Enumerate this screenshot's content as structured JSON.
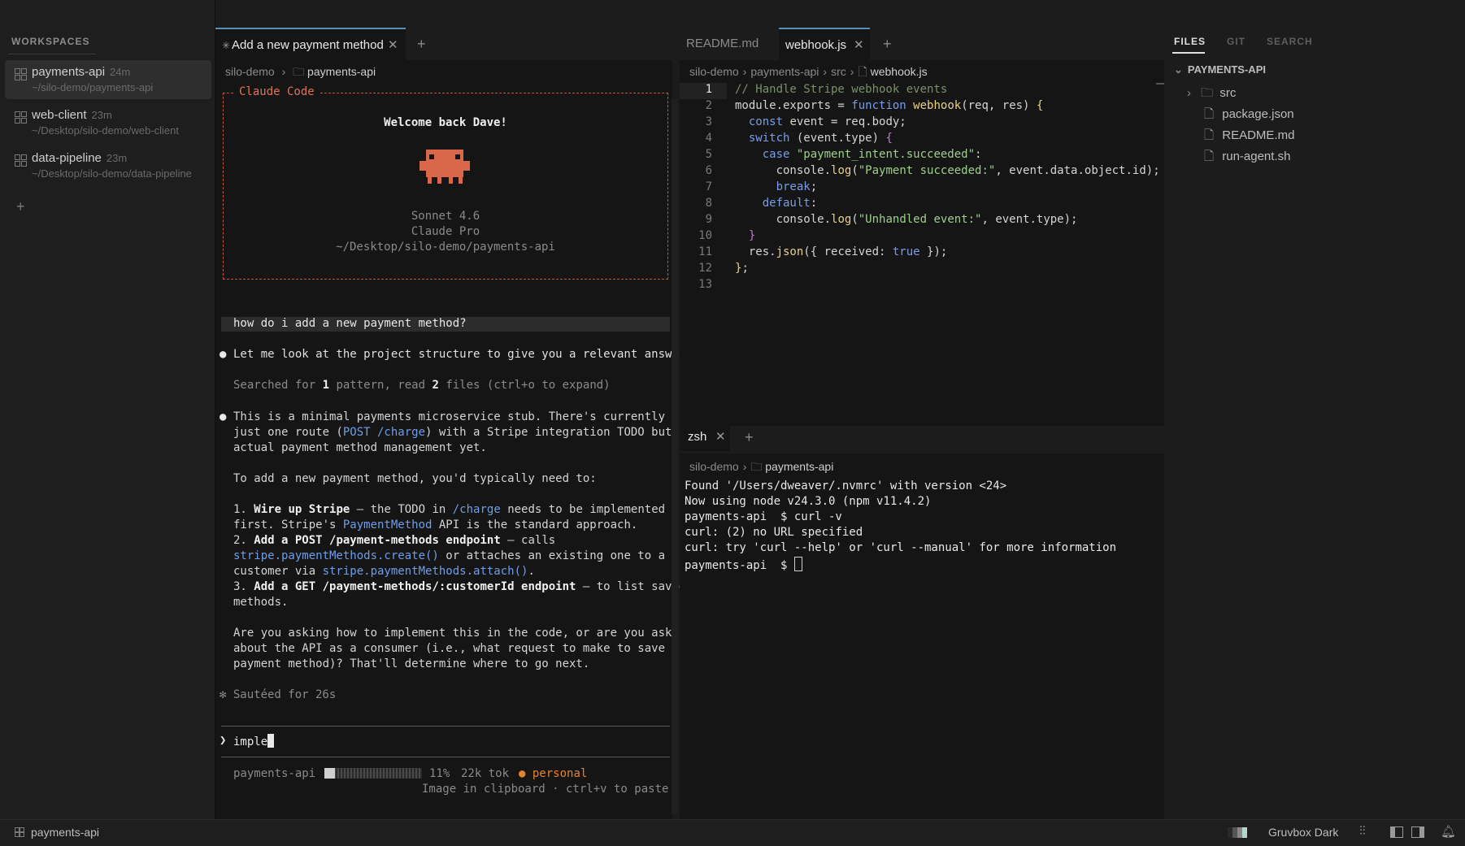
{
  "window": {
    "colors": {
      "close": "#ff5f57",
      "min": "#febc2e",
      "max": "#28c840"
    }
  },
  "sidebar": {
    "title": "WORKSPACES",
    "items": [
      {
        "name": "payments-api",
        "age": "24m",
        "path": "~/silo-demo/payments-api",
        "active": true
      },
      {
        "name": "web-client",
        "age": "23m",
        "path": "~/Desktop/silo-demo/web-client"
      },
      {
        "name": "data-pipeline",
        "age": "23m",
        "path": "~/Desktop/silo-demo/data-pipeline"
      }
    ],
    "add_label": "+"
  },
  "chat": {
    "tab_label": "Add a new payment method",
    "tab_prefix": "✳",
    "breadcrumb": {
      "root": "silo-demo",
      "folder": "payments-api"
    },
    "banner": {
      "title": "Claude Code",
      "welcome": "Welcome back Dave!",
      "model": "Sonnet 4.6",
      "plan": "Claude Pro",
      "cwd": "~/Desktop/silo-demo/payments-api"
    },
    "user_prompt": "how do i add a new payment method?",
    "msg1": "Let me look at the project structure to give you a relevant answer.",
    "search_pre": "Searched for ",
    "search_n1": "1",
    "search_mid": " pattern, read ",
    "search_n2": "2",
    "search_post": " files (ctrl+o to expand)",
    "msg2_l1": "This is a minimal payments microservice stub. There's currently",
    "msg2_l2a": "just one route (",
    "msg2_l2b": "POST /charge",
    "msg2_l2c": ") with a Stripe integration TODO but no",
    "msg2_l3": "actual payment method management yet.",
    "msg3": "To add a new payment method, you'd typically need to:",
    "s1a": "1. ",
    "s1b": "Wire up Stripe",
    "s1c": " — the TODO in ",
    "s1d": "/charge",
    "s1e": " needs to be implemented",
    "s1f": "first. Stripe's ",
    "s1g": "PaymentMethod",
    "s1h": " API is the standard approach.",
    "s2a": "2. ",
    "s2b": "Add a ",
    "s2c": "POST /payment-methods",
    "s2d": " endpoint",
    "s2e": " — calls",
    "s2f": "stripe.paymentMethods.create()",
    "s2g": " or attaches an existing one to a",
    "s2h": "customer via ",
    "s2i": "stripe.paymentMethods.attach()",
    "s2j": ".",
    "s3a": "3. ",
    "s3b": "Add a ",
    "s3c": "GET /payment-methods/:customerId",
    "s3d": " endpoint",
    "s3e": " — to list saved",
    "s3f": "methods.",
    "q1": "Are you asking how to implement this in the code, or are you asking",
    "q2": "about the API as a consumer (i.e., what request to make to save a",
    "q3": "payment method)? That'll determine where to go next.",
    "sauteed": "✻ Sautéed for 26s",
    "input_prompt": "❯",
    "input_value": "imple",
    "status": {
      "project": "payments-api",
      "percent": "11%",
      "progress": 0.11,
      "tokens": "22k tok",
      "account": "personal",
      "hint": "Image in clipboard · ctrl+v to paste"
    }
  },
  "editor": {
    "tabs": [
      {
        "label": "README.md",
        "active": false
      },
      {
        "label": "webhook.js",
        "active": true
      }
    ],
    "breadcrumb": [
      "silo-demo",
      "payments-api",
      "src",
      "webhook.js"
    ],
    "line_numbers": [
      "1",
      "2",
      "3",
      "4",
      "5",
      "6",
      "7",
      "8",
      "9",
      "10",
      "11",
      "12",
      "13"
    ]
  },
  "terminal": {
    "tab_label": "zsh",
    "breadcrumb": {
      "root": "silo-demo",
      "folder": "payments-api"
    },
    "lines": [
      "Found '/Users/dweaver/.nvmrc' with version <24>",
      "Now using node v24.3.0 (npm v11.4.2)",
      "payments-api  $ curl -v",
      "curl: (2) no URL specified",
      "curl: try 'curl --help' or 'curl --manual' for more information",
      "payments-api  $ "
    ]
  },
  "files_panel": {
    "tabs": [
      "FILES",
      "GIT",
      "SEARCH"
    ],
    "root": "PAYMENTS-API",
    "entries": [
      {
        "name": "src",
        "type": "folder"
      },
      {
        "name": "package.json",
        "type": "file"
      },
      {
        "name": "README.md",
        "type": "file"
      },
      {
        "name": "run-agent.sh",
        "type": "file"
      }
    ]
  },
  "statusbar": {
    "workspace": "payments-api",
    "theme": "Gruvbox Dark"
  }
}
